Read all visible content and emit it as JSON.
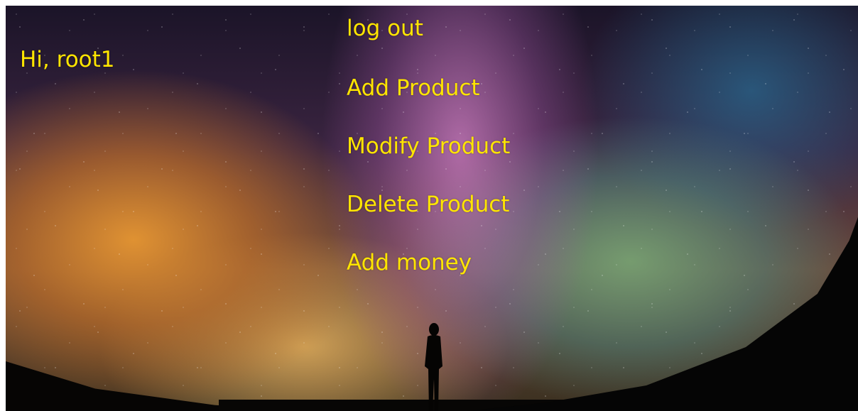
{
  "greeting": {
    "text": "Hi, root1"
  },
  "menu": {
    "items": [
      {
        "label": "log out"
      },
      {
        "label": "Add Product"
      },
      {
        "label": "Modify Product"
      },
      {
        "label": "Delete Product"
      },
      {
        "label": "Add money"
      }
    ]
  },
  "colors": {
    "text": "#ffe500",
    "page_background": "#ffffff"
  }
}
